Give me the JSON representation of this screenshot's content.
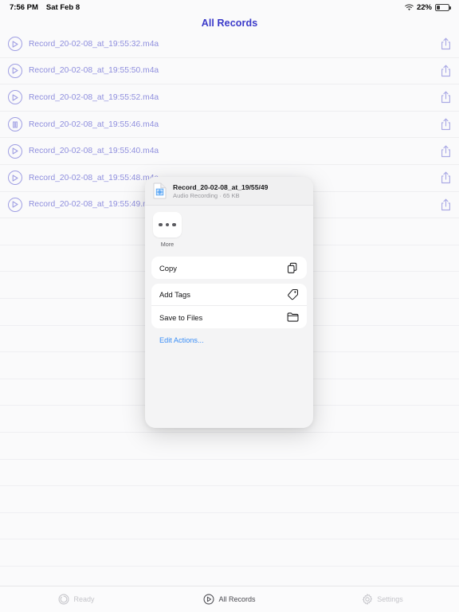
{
  "status_bar": {
    "time": "7:56 PM",
    "date": "Sat Feb 8",
    "wifi_icon": "wifi-icon",
    "battery_percent": "22%",
    "battery_icon": "battery-icon",
    "battery_level": 22
  },
  "nav": {
    "title": "All Records"
  },
  "colors": {
    "accent_blue": "#3a39c9",
    "link_blue": "#3a8ef6",
    "row_icon": "#5b5ad4",
    "share_icon": "#6f6ed8"
  },
  "records": [
    {
      "icon": "play-icon",
      "name": "Record_20-02-08_at_19:55:32.m4a",
      "share_icon": "share-icon"
    },
    {
      "icon": "play-icon",
      "name": "Record_20-02-08_at_19:55:50.m4a",
      "share_icon": "share-icon"
    },
    {
      "icon": "play-icon",
      "name": "Record_20-02-08_at_19:55:52.m4a",
      "share_icon": "share-icon"
    },
    {
      "icon": "pause-icon",
      "name": "Record_20-02-08_at_19:55:46.m4a",
      "share_icon": "share-icon"
    },
    {
      "icon": "play-icon",
      "name": "Record_20-02-08_at_19:55:40.m4a",
      "share_icon": "share-icon"
    },
    {
      "icon": "play-icon",
      "name": "Record_20-02-08_at_19:55:48.m4a",
      "share_icon": "share-icon"
    },
    {
      "icon": "play-icon",
      "name": "Record_20-02-08_at_19:55:49.m4a",
      "share_icon": "share-icon"
    }
  ],
  "empty_rows": 13,
  "share_sheet": {
    "file_icon": "document-icon",
    "file_title": "Record_20-02-08_at_19/55/49",
    "file_subtitle": "Audio Recording · 65 KB",
    "more": {
      "icon": "ellipsis-icon",
      "label": "More"
    },
    "actions": [
      {
        "label": "Copy",
        "icon": "copy-icon"
      },
      {
        "label": "Add Tags",
        "icon": "tag-icon"
      },
      {
        "label": "Save to Files",
        "icon": "folder-icon"
      }
    ],
    "edit_actions_label": "Edit Actions..."
  },
  "tabs": [
    {
      "label": "Ready",
      "icon": "record-icon",
      "active": false
    },
    {
      "label": "All Records",
      "icon": "play-icon",
      "active": true
    },
    {
      "label": "Settings",
      "icon": "gear-icon",
      "active": false
    }
  ]
}
